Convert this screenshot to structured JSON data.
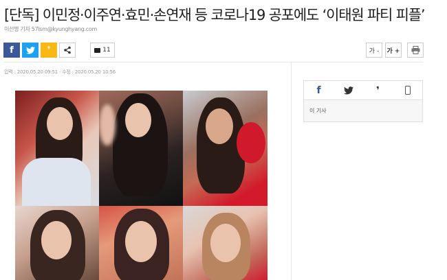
{
  "article": {
    "headline": "[단독] 이민정·이주연·효민·손연재 등 코로나19 공포에도 ‘이태원 파티 피플’",
    "byline": "이선명 기자 57lsm@kyunghyang.com",
    "dates": "입력 : 2020.05.20 09:51 · 수정 : 2020.05.20 10:56"
  },
  "share": {
    "facebook_icon": "f",
    "twitter_icon": "t",
    "kakaostory_icon": "❜",
    "share_icon": "<"
  },
  "comments": {
    "count": "11"
  },
  "tools": {
    "font_down": "가 -",
    "font_up": "가 +",
    "print_icon": "printer-icon"
  },
  "sidebar": {
    "label": "이 기사"
  },
  "colors": {
    "facebook": "#3b5998",
    "twitter": "#1da1f2",
    "kakaostory": "#f9b814"
  }
}
